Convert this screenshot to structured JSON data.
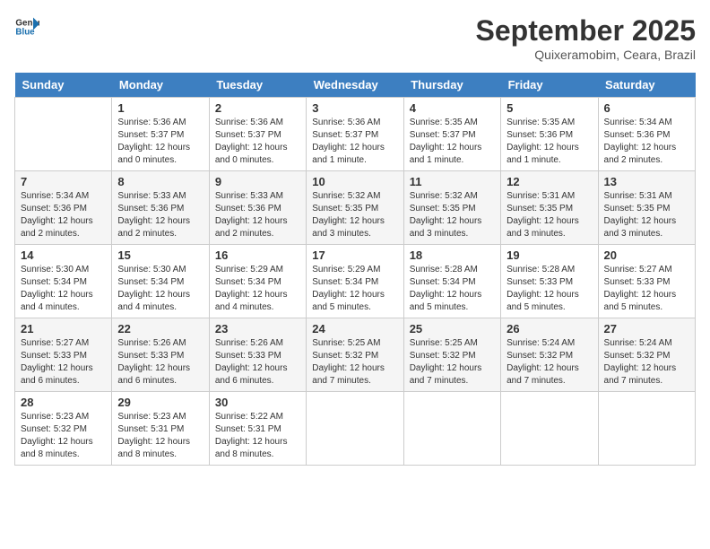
{
  "header": {
    "logo_line1": "General",
    "logo_line2": "Blue",
    "month": "September 2025",
    "location": "Quixeramobim, Ceara, Brazil"
  },
  "weekdays": [
    "Sunday",
    "Monday",
    "Tuesday",
    "Wednesday",
    "Thursday",
    "Friday",
    "Saturday"
  ],
  "weeks": [
    [
      {
        "day": "",
        "sunrise": "",
        "sunset": "",
        "daylight": "",
        "empty": true
      },
      {
        "day": "1",
        "sunrise": "Sunrise: 5:36 AM",
        "sunset": "Sunset: 5:37 PM",
        "daylight": "Daylight: 12 hours and 0 minutes."
      },
      {
        "day": "2",
        "sunrise": "Sunrise: 5:36 AM",
        "sunset": "Sunset: 5:37 PM",
        "daylight": "Daylight: 12 hours and 0 minutes."
      },
      {
        "day": "3",
        "sunrise": "Sunrise: 5:36 AM",
        "sunset": "Sunset: 5:37 PM",
        "daylight": "Daylight: 12 hours and 1 minute."
      },
      {
        "day": "4",
        "sunrise": "Sunrise: 5:35 AM",
        "sunset": "Sunset: 5:37 PM",
        "daylight": "Daylight: 12 hours and 1 minute."
      },
      {
        "day": "5",
        "sunrise": "Sunrise: 5:35 AM",
        "sunset": "Sunset: 5:36 PM",
        "daylight": "Daylight: 12 hours and 1 minute."
      },
      {
        "day": "6",
        "sunrise": "Sunrise: 5:34 AM",
        "sunset": "Sunset: 5:36 PM",
        "daylight": "Daylight: 12 hours and 2 minutes."
      }
    ],
    [
      {
        "day": "7",
        "sunrise": "Sunrise: 5:34 AM",
        "sunset": "Sunset: 5:36 PM",
        "daylight": "Daylight: 12 hours and 2 minutes."
      },
      {
        "day": "8",
        "sunrise": "Sunrise: 5:33 AM",
        "sunset": "Sunset: 5:36 PM",
        "daylight": "Daylight: 12 hours and 2 minutes."
      },
      {
        "day": "9",
        "sunrise": "Sunrise: 5:33 AM",
        "sunset": "Sunset: 5:36 PM",
        "daylight": "Daylight: 12 hours and 2 minutes."
      },
      {
        "day": "10",
        "sunrise": "Sunrise: 5:32 AM",
        "sunset": "Sunset: 5:35 PM",
        "daylight": "Daylight: 12 hours and 3 minutes."
      },
      {
        "day": "11",
        "sunrise": "Sunrise: 5:32 AM",
        "sunset": "Sunset: 5:35 PM",
        "daylight": "Daylight: 12 hours and 3 minutes."
      },
      {
        "day": "12",
        "sunrise": "Sunrise: 5:31 AM",
        "sunset": "Sunset: 5:35 PM",
        "daylight": "Daylight: 12 hours and 3 minutes."
      },
      {
        "day": "13",
        "sunrise": "Sunrise: 5:31 AM",
        "sunset": "Sunset: 5:35 PM",
        "daylight": "Daylight: 12 hours and 3 minutes."
      }
    ],
    [
      {
        "day": "14",
        "sunrise": "Sunrise: 5:30 AM",
        "sunset": "Sunset: 5:34 PM",
        "daylight": "Daylight: 12 hours and 4 minutes."
      },
      {
        "day": "15",
        "sunrise": "Sunrise: 5:30 AM",
        "sunset": "Sunset: 5:34 PM",
        "daylight": "Daylight: 12 hours and 4 minutes."
      },
      {
        "day": "16",
        "sunrise": "Sunrise: 5:29 AM",
        "sunset": "Sunset: 5:34 PM",
        "daylight": "Daylight: 12 hours and 4 minutes."
      },
      {
        "day": "17",
        "sunrise": "Sunrise: 5:29 AM",
        "sunset": "Sunset: 5:34 PM",
        "daylight": "Daylight: 12 hours and 5 minutes."
      },
      {
        "day": "18",
        "sunrise": "Sunrise: 5:28 AM",
        "sunset": "Sunset: 5:34 PM",
        "daylight": "Daylight: 12 hours and 5 minutes."
      },
      {
        "day": "19",
        "sunrise": "Sunrise: 5:28 AM",
        "sunset": "Sunset: 5:33 PM",
        "daylight": "Daylight: 12 hours and 5 minutes."
      },
      {
        "day": "20",
        "sunrise": "Sunrise: 5:27 AM",
        "sunset": "Sunset: 5:33 PM",
        "daylight": "Daylight: 12 hours and 5 minutes."
      }
    ],
    [
      {
        "day": "21",
        "sunrise": "Sunrise: 5:27 AM",
        "sunset": "Sunset: 5:33 PM",
        "daylight": "Daylight: 12 hours and 6 minutes."
      },
      {
        "day": "22",
        "sunrise": "Sunrise: 5:26 AM",
        "sunset": "Sunset: 5:33 PM",
        "daylight": "Daylight: 12 hours and 6 minutes."
      },
      {
        "day": "23",
        "sunrise": "Sunrise: 5:26 AM",
        "sunset": "Sunset: 5:33 PM",
        "daylight": "Daylight: 12 hours and 6 minutes."
      },
      {
        "day": "24",
        "sunrise": "Sunrise: 5:25 AM",
        "sunset": "Sunset: 5:32 PM",
        "daylight": "Daylight: 12 hours and 7 minutes."
      },
      {
        "day": "25",
        "sunrise": "Sunrise: 5:25 AM",
        "sunset": "Sunset: 5:32 PM",
        "daylight": "Daylight: 12 hours and 7 minutes."
      },
      {
        "day": "26",
        "sunrise": "Sunrise: 5:24 AM",
        "sunset": "Sunset: 5:32 PM",
        "daylight": "Daylight: 12 hours and 7 minutes."
      },
      {
        "day": "27",
        "sunrise": "Sunrise: 5:24 AM",
        "sunset": "Sunset: 5:32 PM",
        "daylight": "Daylight: 12 hours and 7 minutes."
      }
    ],
    [
      {
        "day": "28",
        "sunrise": "Sunrise: 5:23 AM",
        "sunset": "Sunset: 5:32 PM",
        "daylight": "Daylight: 12 hours and 8 minutes."
      },
      {
        "day": "29",
        "sunrise": "Sunrise: 5:23 AM",
        "sunset": "Sunset: 5:31 PM",
        "daylight": "Daylight: 12 hours and 8 minutes."
      },
      {
        "day": "30",
        "sunrise": "Sunrise: 5:22 AM",
        "sunset": "Sunset: 5:31 PM",
        "daylight": "Daylight: 12 hours and 8 minutes."
      },
      {
        "day": "",
        "sunrise": "",
        "sunset": "",
        "daylight": "",
        "empty": true
      },
      {
        "day": "",
        "sunrise": "",
        "sunset": "",
        "daylight": "",
        "empty": true
      },
      {
        "day": "",
        "sunrise": "",
        "sunset": "",
        "daylight": "",
        "empty": true
      },
      {
        "day": "",
        "sunrise": "",
        "sunset": "",
        "daylight": "",
        "empty": true
      }
    ]
  ]
}
